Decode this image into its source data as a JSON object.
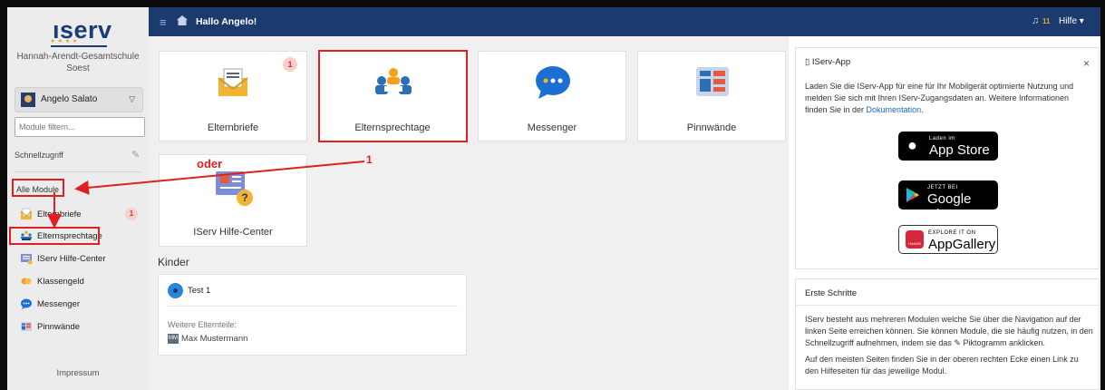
{
  "sidebar": {
    "logo": "ıserv",
    "school": "Hannah-Arendt-Gesamtschule Soest",
    "user_name": "Angelo Salato",
    "filter_placeholder": "Module filtern...",
    "quick_access": "Schnellzugriff",
    "all_modules": "Alle Module",
    "items": [
      {
        "label": "Elternbriefe",
        "icon": "letter-icon",
        "badge": "1"
      },
      {
        "label": "Elternsprechtage",
        "icon": "meeting-icon"
      },
      {
        "label": "IServ Hilfe-Center",
        "icon": "help-center-icon"
      },
      {
        "label": "Klassengeld",
        "icon": "money-icon"
      },
      {
        "label": "Messenger",
        "icon": "chat-icon"
      },
      {
        "label": "Pinnwände",
        "icon": "board-icon"
      }
    ],
    "impressum": "Impressum"
  },
  "topbar": {
    "greeting": "Hallo Angelo!",
    "notifications": "11",
    "help": "Hilfe ▾"
  },
  "tiles": [
    {
      "label": "Elternbriefe",
      "icon": "letter-icon",
      "badge": "1"
    },
    {
      "label": "Elternsprechtage",
      "icon": "meeting-icon"
    },
    {
      "label": "Messenger",
      "icon": "chat-icon"
    },
    {
      "label": "Pinnwände",
      "icon": "board-icon"
    },
    {
      "label": "IServ Hilfe-Center",
      "icon": "help-center-icon"
    }
  ],
  "annotations": {
    "oder": "oder",
    "step": "1"
  },
  "kinder": {
    "title": "Kinder",
    "child_name": "Test 1",
    "other_parents_label": "Weitere Elternteile:",
    "parent_initials": "MM",
    "parent_name": "Max Mustermann"
  },
  "app_panel": {
    "title": "IServ-App",
    "close": "×",
    "text_before": "Laden Sie die IServ-App für eine für Ihr Mobilgerät optimierte Nutzung und melden Sie sich mit Ihren IServ-Zugangsdaten an. Weitere Informationen finden Sie in der ",
    "link": "Dokumentation",
    "text_after": ".",
    "appstore_small": "Laden im",
    "appstore_big": "App Store",
    "googleplay_small": "JETZT BEI",
    "googleplay_big": "Google Play",
    "appgallery_small": "EXPLORE IT ON",
    "appgallery_big": "AppGallery",
    "huawei_label": "HUAWEI"
  },
  "first_steps": {
    "title": "Erste Schritte",
    "p1": "IServ besteht aus mehreren Modulen welche Sie über die Navigation auf der linken Seite erreichen können. Sie können Module, die sie häufig nutzen, in den Schnellzugriff aufnehmen, indem sie das ✎ Piktogramm anklicken.",
    "p2": "Auf den meisten Seiten finden Sie in der oberen rechten Ecke einen Link zu den Hilfeseiten für das jeweilige Modul."
  },
  "colors": {
    "brand_navy": "#1b3a6e",
    "annotation_red": "#e02020",
    "badge_bg": "#f6d0cb"
  }
}
